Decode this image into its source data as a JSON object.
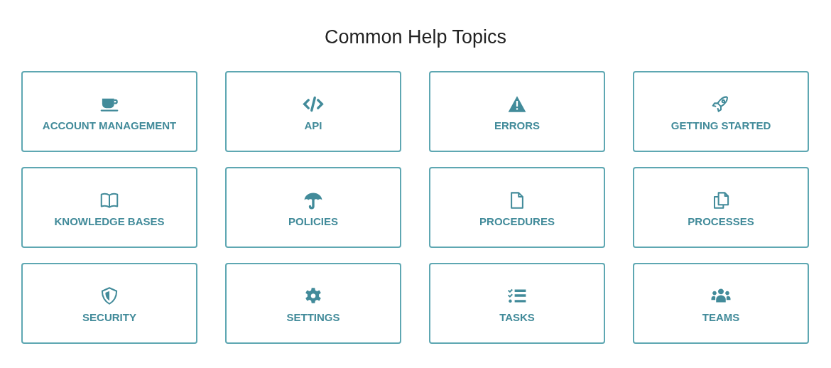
{
  "title": "Common Help Topics",
  "topics": [
    {
      "label": "ACCOUNT MANAGEMENT"
    },
    {
      "label": "API"
    },
    {
      "label": "ERRORS"
    },
    {
      "label": "GETTING STARTED"
    },
    {
      "label": "KNOWLEDGE BASES"
    },
    {
      "label": "POLICIES"
    },
    {
      "label": "PROCEDURES"
    },
    {
      "label": "PROCESSES"
    },
    {
      "label": "SECURITY"
    },
    {
      "label": "SETTINGS"
    },
    {
      "label": "TASKS"
    },
    {
      "label": "TEAMS"
    }
  ]
}
